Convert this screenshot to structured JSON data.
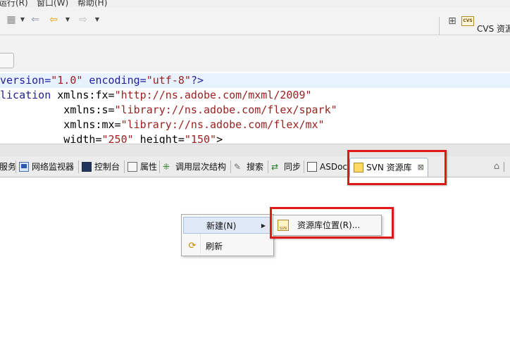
{
  "menubar": {
    "items": [
      "运行(R)",
      "窗口(W)",
      "帮助(H)"
    ]
  },
  "toolbar": {
    "icons": [
      "save-icon",
      "dropdown-caret",
      "back-icon",
      "back-nav-icon",
      "dropdown-caret",
      "forward-nav-icon",
      "dropdown-caret"
    ],
    "perspective": {
      "icon": "open-perspective-icon",
      "cvs_badge": "CVS",
      "label": "CVS 资源库"
    }
  },
  "editor": {
    "lines": [
      {
        "parts": [
          {
            "t": "version=",
            "c": "kw"
          },
          {
            "t": "\"1.0\"",
            "c": "str"
          },
          {
            "t": " encoding=",
            "c": "kw"
          },
          {
            "t": "\"utf-8\"",
            "c": "str"
          },
          {
            "t": "?>",
            "c": "kw"
          }
        ]
      },
      {
        "parts": [
          {
            "t": "lication",
            "c": "kw"
          },
          {
            "t": " xmlns:fx=",
            "c": ""
          },
          {
            "t": "\"http://ns.adobe.com/mxml/2009\"",
            "c": "str"
          }
        ]
      },
      {
        "parts": [
          {
            "t": "          xmlns:s=",
            "c": ""
          },
          {
            "t": "\"library://ns.adobe.com/flex/spark\"",
            "c": "str"
          }
        ]
      },
      {
        "parts": [
          {
            "t": "          xmlns:mx=",
            "c": ""
          },
          {
            "t": "\"library://ns.adobe.com/flex/mx\"",
            "c": "str"
          }
        ]
      },
      {
        "parts": [
          {
            "t": "          width=",
            "c": ""
          },
          {
            "t": "\"250\"",
            "c": "str"
          },
          {
            "t": " height=",
            "c": ""
          },
          {
            "t": "\"150\"",
            "c": "str"
          },
          {
            "t": ">",
            "c": ""
          }
        ]
      }
    ]
  },
  "tabs": [
    {
      "label": "服务",
      "icon": ""
    },
    {
      "label": "网络监视器",
      "icon": "network-monitor-icon"
    },
    {
      "label": "控制台",
      "icon": "console-icon"
    },
    {
      "label": "属性",
      "icon": "properties-icon"
    },
    {
      "label": "调用层次结构",
      "icon": "call-hierarchy-icon"
    },
    {
      "label": "搜索",
      "icon": "search-icon"
    },
    {
      "label": "同步",
      "icon": "synchronize-icon"
    },
    {
      "label": "ASDoc",
      "icon": "asdoc-icon"
    }
  ],
  "active_tab": {
    "label": "SVN 资源库",
    "icon": "svn-repository-icon",
    "close": "⊠"
  },
  "context_menu": {
    "items": [
      {
        "label": "新建(N)",
        "has_submenu": true,
        "selected": true
      },
      {
        "label": "刷新",
        "icon": "refresh-icon"
      }
    ]
  },
  "submenu": {
    "items": [
      {
        "label": "资源库位置(R)...",
        "icon": "svn-repository-location-icon",
        "badge": "SVN"
      }
    ]
  },
  "colors": {
    "highlight_box": "#e01818",
    "menu_selection": "#dfe9f7",
    "string_literal": "#9b1f1f",
    "attribute_name": "#1f1f9b"
  }
}
